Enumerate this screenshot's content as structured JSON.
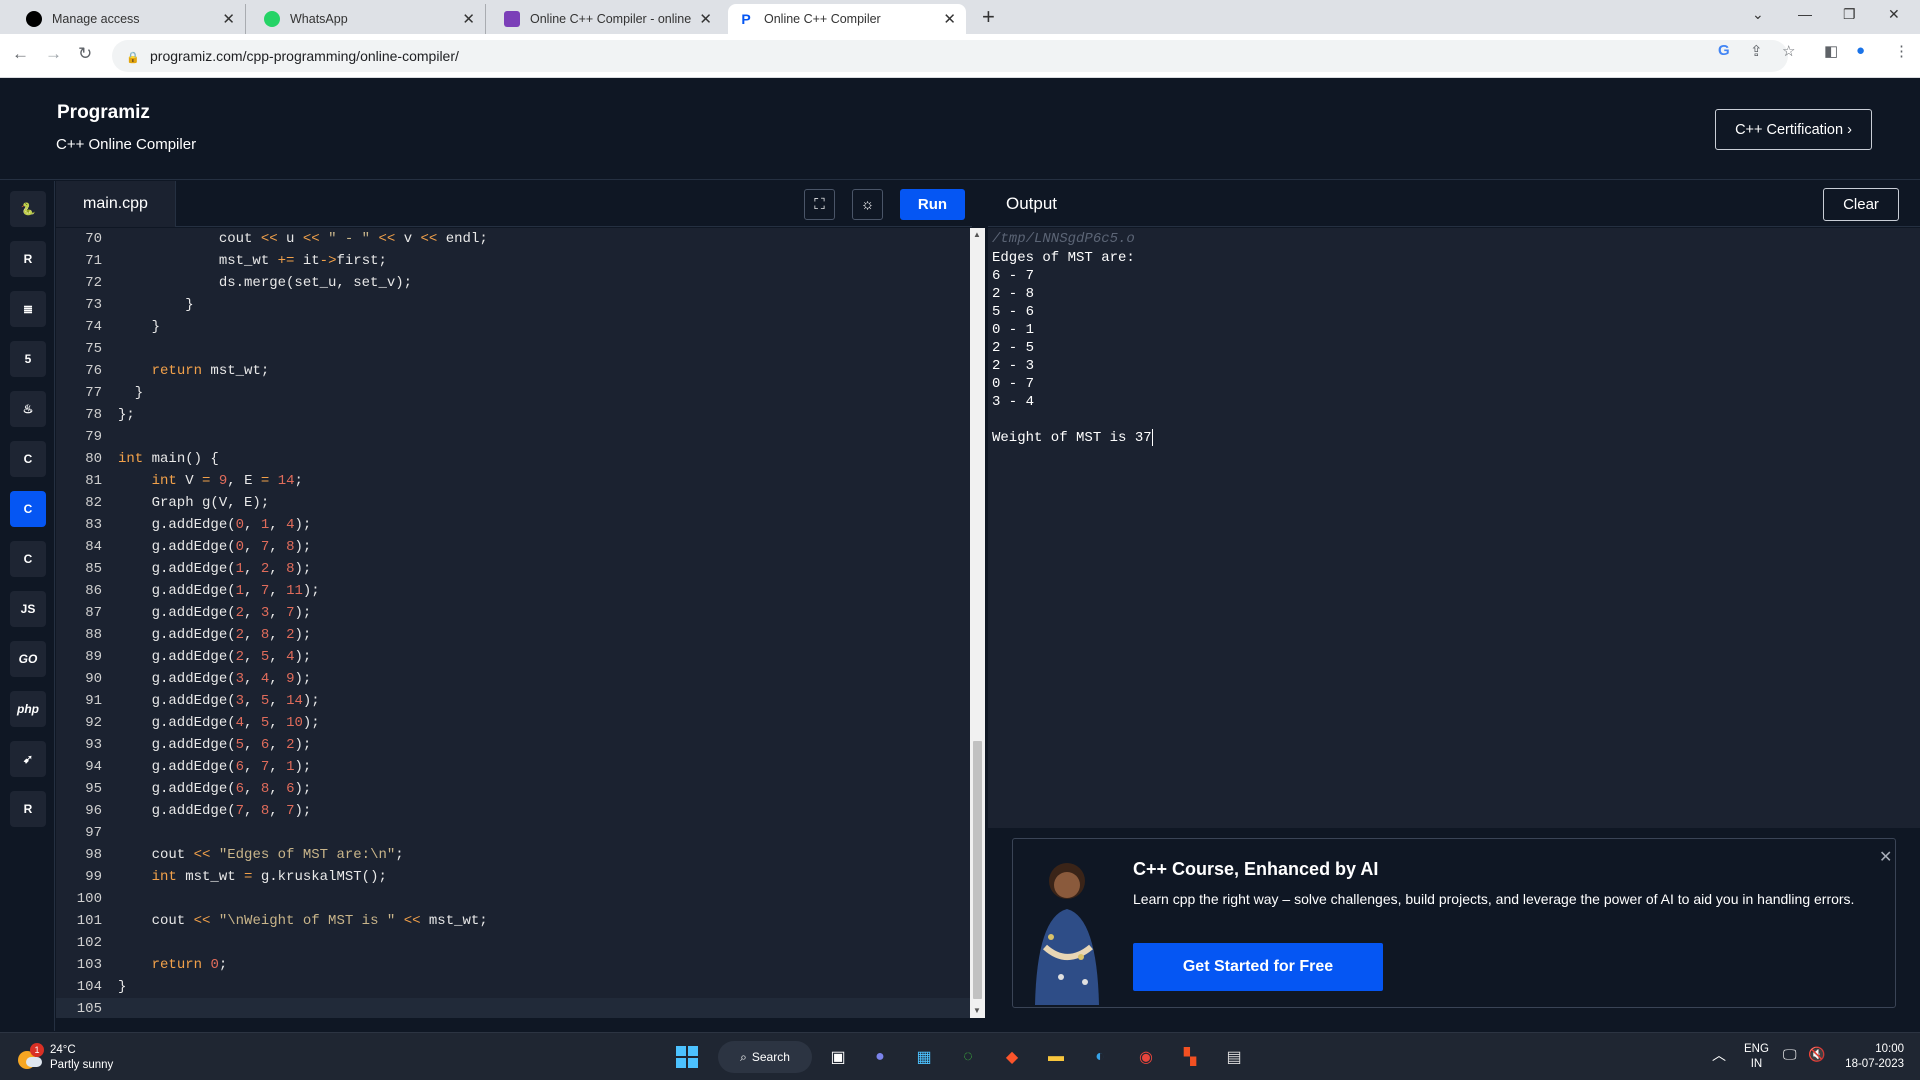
{
  "browser": {
    "tabs": [
      {
        "title": "Manage access",
        "icon": "github-icon"
      },
      {
        "title": "WhatsApp",
        "icon": "whatsapp-icon"
      },
      {
        "title": "Online C++ Compiler - online e",
        "icon": "compiler-icon"
      },
      {
        "title": "Online C++ Compiler",
        "icon": "programiz-icon"
      }
    ],
    "url": "programiz.com/cpp-programming/online-compiler/"
  },
  "site": {
    "logo": "Programiz",
    "subtitle": "C++ Online Compiler",
    "cert_button": "C++ Certification ›"
  },
  "sidebar": {
    "languages": [
      {
        "name": "python",
        "glyph": "🐍",
        "active": false
      },
      {
        "name": "r",
        "glyph": "R",
        "active": false
      },
      {
        "name": "sql",
        "glyph": "≣",
        "active": false
      },
      {
        "name": "html",
        "glyph": "5",
        "active": false
      },
      {
        "name": "java",
        "glyph": "♨",
        "active": false
      },
      {
        "name": "c",
        "glyph": "C",
        "active": false
      },
      {
        "name": "cpp",
        "glyph": "C",
        "active": true
      },
      {
        "name": "csharp",
        "glyph": "C",
        "active": false
      },
      {
        "name": "javascript",
        "glyph": "JS",
        "active": false
      },
      {
        "name": "go",
        "glyph": "GO",
        "active": false
      },
      {
        "name": "php",
        "glyph": "php",
        "active": false
      },
      {
        "name": "swift",
        "glyph": "➹",
        "active": false
      },
      {
        "name": "rust",
        "glyph": "R",
        "active": false
      }
    ]
  },
  "editor": {
    "filename": "main.cpp",
    "run_label": "Run",
    "lines": [
      {
        "n": "70",
        "html": "            cout <span class='k'>&lt;&lt;</span> u <span class='k'>&lt;&lt;</span> <span class='s'>\" - \"</span> <span class='k'>&lt;&lt;</span> v <span class='k'>&lt;&lt;</span> endl;"
      },
      {
        "n": "71",
        "html": "            mst_wt <span class='k'>+=</span> it<span class='k'>-&gt;</span>first;"
      },
      {
        "n": "72",
        "html": "            ds.merge(set_u, set_v);"
      },
      {
        "n": "73",
        "html": "        }"
      },
      {
        "n": "74",
        "html": "    }"
      },
      {
        "n": "75",
        "html": ""
      },
      {
        "n": "76",
        "html": "    <span class='k'>return</span> mst_wt;"
      },
      {
        "n": "77",
        "html": "  }"
      },
      {
        "n": "78",
        "html": "};"
      },
      {
        "n": "79",
        "html": ""
      },
      {
        "n": "80",
        "html": "<span class='k'>int</span> main() {"
      },
      {
        "n": "81",
        "html": "    <span class='k'>int</span> V <span class='k'>=</span> <span class='n'>9</span>, E <span class='k'>=</span> <span class='n'>14</span>;"
      },
      {
        "n": "82",
        "html": "    Graph g(V, E);"
      },
      {
        "n": "83",
        "html": "    g.addEdge(<span class='n'>0</span>, <span class='n'>1</span>, <span class='n'>4</span>);"
      },
      {
        "n": "84",
        "html": "    g.addEdge(<span class='n'>0</span>, <span class='n'>7</span>, <span class='n'>8</span>);"
      },
      {
        "n": "85",
        "html": "    g.addEdge(<span class='n'>1</span>, <span class='n'>2</span>, <span class='n'>8</span>);"
      },
      {
        "n": "86",
        "html": "    g.addEdge(<span class='n'>1</span>, <span class='n'>7</span>, <span class='n'>11</span>);"
      },
      {
        "n": "87",
        "html": "    g.addEdge(<span class='n'>2</span>, <span class='n'>3</span>, <span class='n'>7</span>);"
      },
      {
        "n": "88",
        "html": "    g.addEdge(<span class='n'>2</span>, <span class='n'>8</span>, <span class='n'>2</span>);"
      },
      {
        "n": "89",
        "html": "    g.addEdge(<span class='n'>2</span>, <span class='n'>5</span>, <span class='n'>4</span>);"
      },
      {
        "n": "90",
        "html": "    g.addEdge(<span class='n'>3</span>, <span class='n'>4</span>, <span class='n'>9</span>);"
      },
      {
        "n": "91",
        "html": "    g.addEdge(<span class='n'>3</span>, <span class='n'>5</span>, <span class='n'>14</span>);"
      },
      {
        "n": "92",
        "html": "    g.addEdge(<span class='n'>4</span>, <span class='n'>5</span>, <span class='n'>10</span>);"
      },
      {
        "n": "93",
        "html": "    g.addEdge(<span class='n'>5</span>, <span class='n'>6</span>, <span class='n'>2</span>);"
      },
      {
        "n": "94",
        "html": "    g.addEdge(<span class='n'>6</span>, <span class='n'>7</span>, <span class='n'>1</span>);"
      },
      {
        "n": "95",
        "html": "    g.addEdge(<span class='n'>6</span>, <span class='n'>8</span>, <span class='n'>6</span>);"
      },
      {
        "n": "96",
        "html": "    g.addEdge(<span class='n'>7</span>, <span class='n'>8</span>, <span class='n'>7</span>);"
      },
      {
        "n": "97",
        "html": ""
      },
      {
        "n": "98",
        "html": "    cout <span class='k'>&lt;&lt;</span> <span class='s'>\"Edges of MST are:\\n\"</span>;"
      },
      {
        "n": "99",
        "html": "    <span class='k'>int</span> mst_wt <span class='k'>=</span> g.kruskalMST();"
      },
      {
        "n": "100",
        "html": ""
      },
      {
        "n": "101",
        "html": "    cout <span class='k'>&lt;&lt;</span> <span class='s'>\"\\nWeight of MST is \"</span> <span class='k'>&lt;&lt;</span> mst_wt;"
      },
      {
        "n": "102",
        "html": ""
      },
      {
        "n": "103",
        "html": "    <span class='k'>return</span> <span class='n'>0</span>;"
      },
      {
        "n": "104",
        "html": "}"
      },
      {
        "n": "105",
        "html": ""
      }
    ]
  },
  "output": {
    "title": "Output",
    "clear_label": "Clear",
    "path": "/tmp/LNNSgdP6c5.o",
    "lines": [
      "Edges of MST are:",
      "6 - 7",
      "2 - 8",
      "5 - 6",
      "0 - 1",
      "2 - 5",
      "2 - 3",
      "0 - 7",
      "3 - 4",
      "",
      "Weight of MST is 37"
    ]
  },
  "ad": {
    "title": "C++ Course, Enhanced by AI",
    "text": "Learn cpp the right way – solve challenges, build projects, and leverage the power of AI to aid you in handling errors.",
    "button": "Get Started for Free"
  },
  "taskbar": {
    "temperature": "24°C",
    "weather": "Partly sunny",
    "badge": "1",
    "search_label": "Search",
    "lang": "ENG",
    "region": "IN",
    "time": "10:00",
    "date": "18-07-2023"
  },
  "colors": {
    "accent": "#0556f3",
    "bg": "#0f1724",
    "editor_bg": "#1b2230"
  }
}
